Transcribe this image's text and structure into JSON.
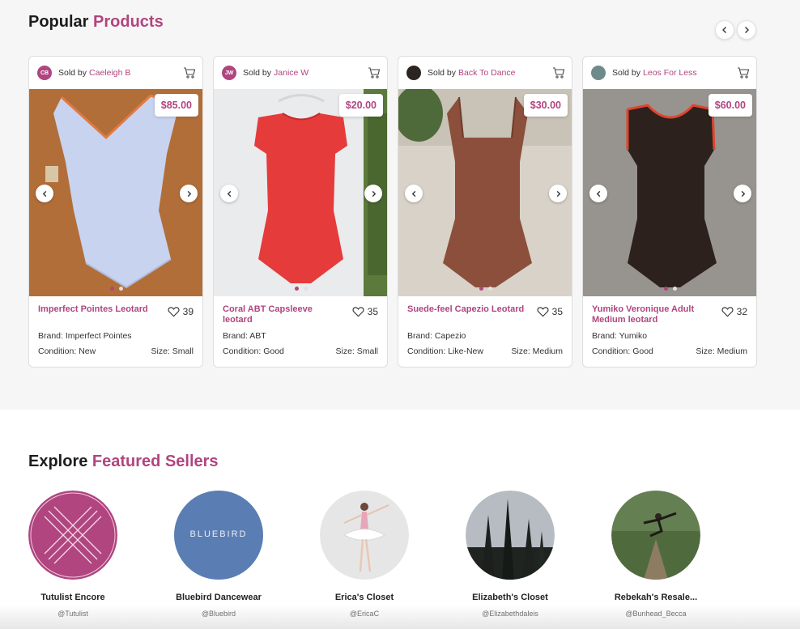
{
  "popular": {
    "title_main": "Popular",
    "title_accent": "Products",
    "prev_icon": "chevron-left-icon",
    "next_icon": "chevron-right-icon"
  },
  "products": [
    {
      "seller_prefix": "Sold by",
      "seller": "Caeleigh B",
      "avatar_initials": "CB",
      "price": "$85.00",
      "name": "Imperfect Pointes Leotard",
      "likes": "39",
      "brand": "Brand: Imperfect Pointes",
      "condition": "Condition: New",
      "size": "Size: Small"
    },
    {
      "seller_prefix": "Sold by",
      "seller": "Janice W",
      "avatar_initials": "JW",
      "price": "$20.00",
      "name": "Coral ABT Capsleeve leotard",
      "likes": "35",
      "brand": "Brand: ABT",
      "condition": "Condition: Good",
      "size": "Size: Small"
    },
    {
      "seller_prefix": "Sold by",
      "seller": "Back To Dance",
      "avatar_initials": "",
      "price": "$30.00",
      "name": "Suede-feel Capezio Leotard",
      "likes": "35",
      "brand": "Brand: Capezio",
      "condition": "Condition: Like-New",
      "size": "Size: Medium"
    },
    {
      "seller_prefix": "Sold by",
      "seller": "Leos For Less",
      "avatar_initials": "",
      "price": "$60.00",
      "name": "Yumiko Veronique Adult Medium leotard",
      "likes": "32",
      "brand": "Brand: Yumiko",
      "condition": "Condition: Good",
      "size": "Size: Medium"
    }
  ],
  "featured": {
    "title_main": "Explore",
    "title_accent": "Featured Sellers",
    "sellers": [
      {
        "name": "Tutulist Encore",
        "handle": "@Tutulist"
      },
      {
        "name": "Bluebird Dancewear",
        "handle": "@Bluebird",
        "logo_text": "BLUEBIRD"
      },
      {
        "name": "Erica's Closet",
        "handle": "@EricaC"
      },
      {
        "name": "Elizabeth's Closet",
        "handle": "@Elizabethdaleis"
      },
      {
        "name": "Rebekah's Resale...",
        "handle": "@Bunhead_Becca"
      }
    ]
  },
  "colors": {
    "accent": "#b0457f",
    "section_bg": "#f7f6f6"
  }
}
